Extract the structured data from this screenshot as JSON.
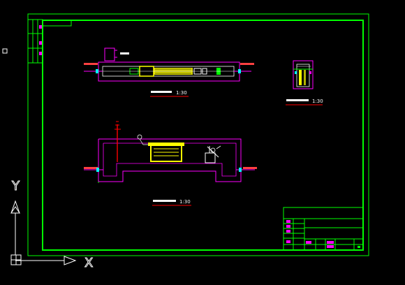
{
  "drawing": {
    "views": [
      {
        "scale": "1:30"
      },
      {
        "scale": "1:30"
      },
      {
        "scale": "1:30"
      }
    ]
  },
  "ucs": {
    "y_label": "Y",
    "x_label": "X"
  },
  "colors": {
    "background": "#000000",
    "frame": "#00ff00",
    "outline": "#ff00ff",
    "equipment": "#ffff00",
    "detail": "#ffffff",
    "pipe": "#ff0000",
    "annotation": "#00ffff",
    "caption_text": "#ffffff",
    "caption_underline": "#ff0000"
  }
}
